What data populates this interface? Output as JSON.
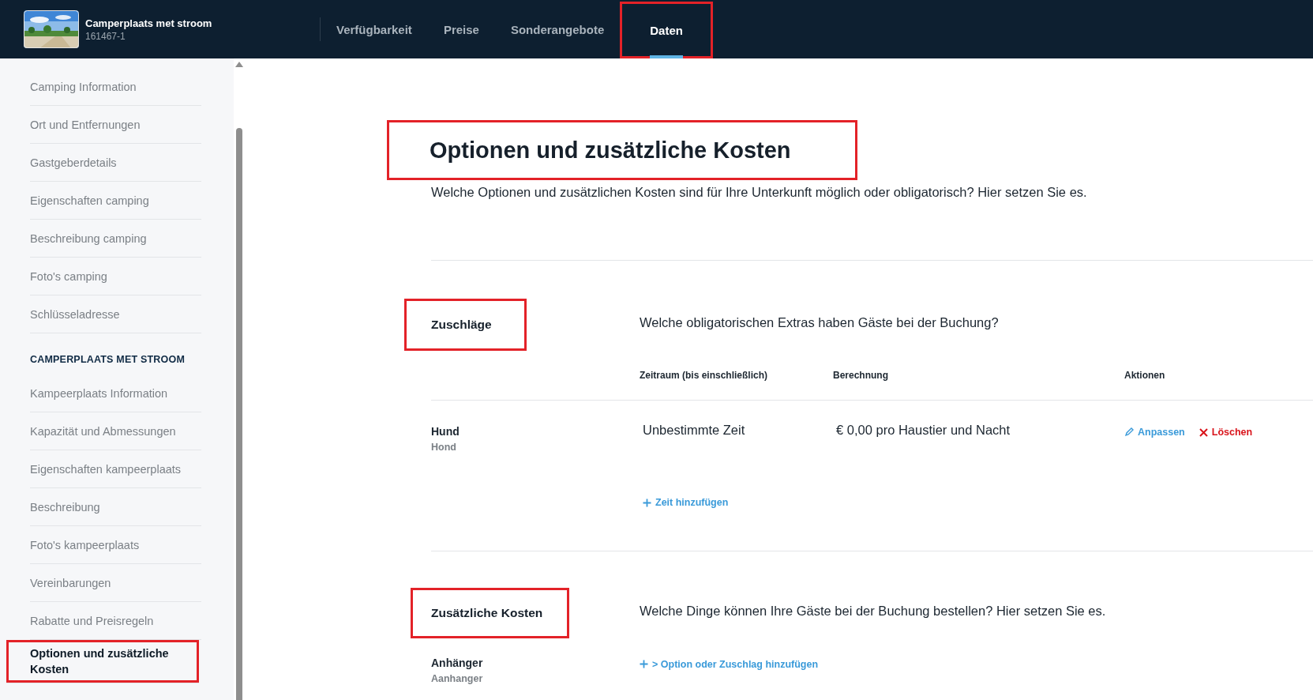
{
  "listing": {
    "title": "Camperplaats met stroom",
    "id": "161467-1"
  },
  "tabs": [
    {
      "label": "Verfügbarkeit",
      "selected": false,
      "highlighted": false
    },
    {
      "label": "Preise",
      "selected": false,
      "highlighted": false
    },
    {
      "label": "Sonderangebote",
      "selected": false,
      "highlighted": false
    },
    {
      "label": "Daten",
      "selected": true,
      "highlighted": true
    }
  ],
  "sidebar": {
    "groups": [
      {
        "items": [
          {
            "label": "Camping Information",
            "selected": false,
            "highlighted": false
          },
          {
            "label": "Ort und Entfernungen",
            "selected": false,
            "highlighted": false
          },
          {
            "label": "Gastgeberdetails",
            "selected": false,
            "highlighted": false
          },
          {
            "label": "Eigenschaften camping",
            "selected": false,
            "highlighted": false
          },
          {
            "label": "Beschreibung camping",
            "selected": false,
            "highlighted": false
          },
          {
            "label": "Foto's camping",
            "selected": false,
            "highlighted": false
          },
          {
            "label": "Schlüsseladresse",
            "selected": false,
            "highlighted": false
          }
        ]
      },
      {
        "heading": "CAMPERPLAATS MET STROOM",
        "items": [
          {
            "label": "Kampeerplaats Information",
            "selected": false,
            "highlighted": false
          },
          {
            "label": "Kapazität und Abmessungen",
            "selected": false,
            "highlighted": false
          },
          {
            "label": "Eigenschaften kampeerplaats",
            "selected": false,
            "highlighted": false
          },
          {
            "label": "Beschreibung",
            "selected": false,
            "highlighted": false
          },
          {
            "label": "Foto's kampeerplaats",
            "selected": false,
            "highlighted": false
          },
          {
            "label": "Vereinbarungen",
            "selected": false,
            "highlighted": false
          },
          {
            "label": "Rabatte und Preisregeln",
            "selected": false,
            "highlighted": false
          },
          {
            "label": "Optionen und zusätzliche Kosten",
            "selected": true,
            "highlighted": true
          }
        ]
      }
    ]
  },
  "page": {
    "title": "Optionen und zusätzliche Kosten",
    "highlighted": true,
    "intro": "Welche Optionen und zusätzlichen Kosten sind für Ihre Unterkunft möglich oder obligatorisch? Hier setzen Sie es."
  },
  "surcharges": {
    "title": "Zuschläge",
    "highlighted": true,
    "question": "Welche obligatorischen Extras haben Gäste bei der Buchung?",
    "columns": [
      "Zeitraum (bis einschließlich)",
      "Berechnung",
      "Aktionen"
    ],
    "rows": [
      {
        "name": "Hund",
        "translation": "Hond",
        "period": "Unbestimmte Zeit",
        "calculation": "€ 0,00 pro Haustier und Nacht",
        "add_time": "Zeit hinzufügen",
        "actions": [
          {
            "kind": "edit",
            "label": "Anpassen"
          },
          {
            "kind": "delete",
            "label": "Löschen"
          }
        ]
      }
    ]
  },
  "extra_costs": {
    "title": "Zusätzliche Kosten",
    "highlighted": true,
    "question": "Welche Dinge können Ihre Gäste bei der Buchung bestellen? Hier setzen Sie es.",
    "rows": [
      {
        "name": "Anhänger",
        "translation": "Aanhanger",
        "add_option": "> Option oder Zuschlag hinzufügen"
      }
    ]
  }
}
